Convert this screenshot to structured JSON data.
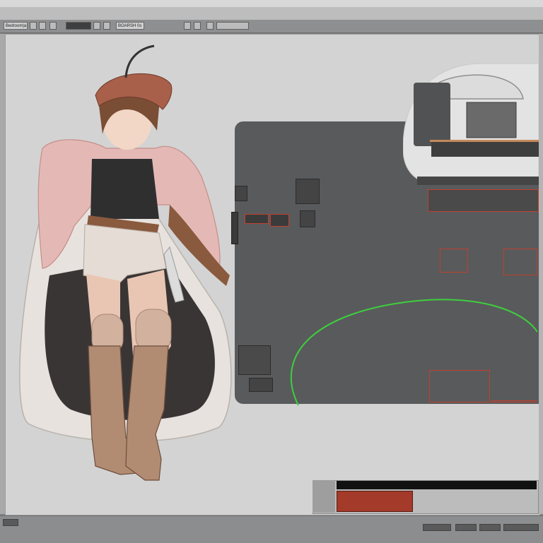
{
  "app": {
    "menubar_labels": [
      "",
      "",
      "",
      ""
    ],
    "tab_label": "Bedroom|a",
    "toolbar_tab2": "BOARSH 0s",
    "canvas_title": ""
  },
  "status": {
    "tab_a": "",
    "tab_b": ""
  },
  "bottom_widget": {
    "row_label": "",
    "black_labels": [
      "",
      "",
      ""
    ]
  },
  "colors": {
    "canvas_bg": "#d3d3d3",
    "panel_bg": "#595a5c",
    "accent_red": "#c0402c",
    "arc_green": "#3ecf3e"
  },
  "icons": {
    "character": "anime-character-illustration",
    "dome": "dome-object",
    "arc": "green-arc-guide"
  }
}
